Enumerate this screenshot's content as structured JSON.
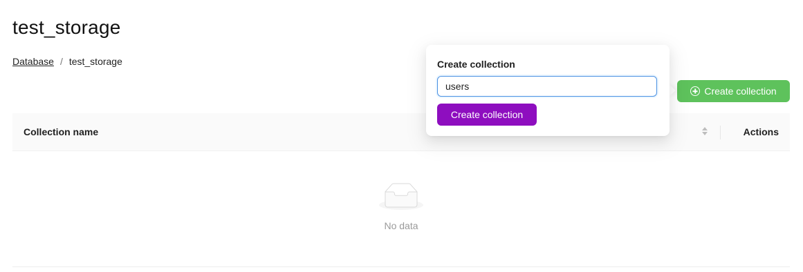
{
  "header": {
    "title": "test_storage",
    "breadcrumb": {
      "root": "Database",
      "separator": "/",
      "current": "test_storage"
    }
  },
  "toolbar": {
    "create_label": "Create collection",
    "create_icon": "plus-circle-icon"
  },
  "table": {
    "columns": [
      "Collection name",
      "Actions"
    ],
    "rows": [],
    "empty_text": "No data"
  },
  "popover": {
    "title": "Create collection",
    "input_value": "users",
    "submit_label": "Create collection"
  },
  "colors": {
    "primary": "#5ec25c",
    "submit": "#8e0ebf",
    "focus": "#4a90e2"
  }
}
